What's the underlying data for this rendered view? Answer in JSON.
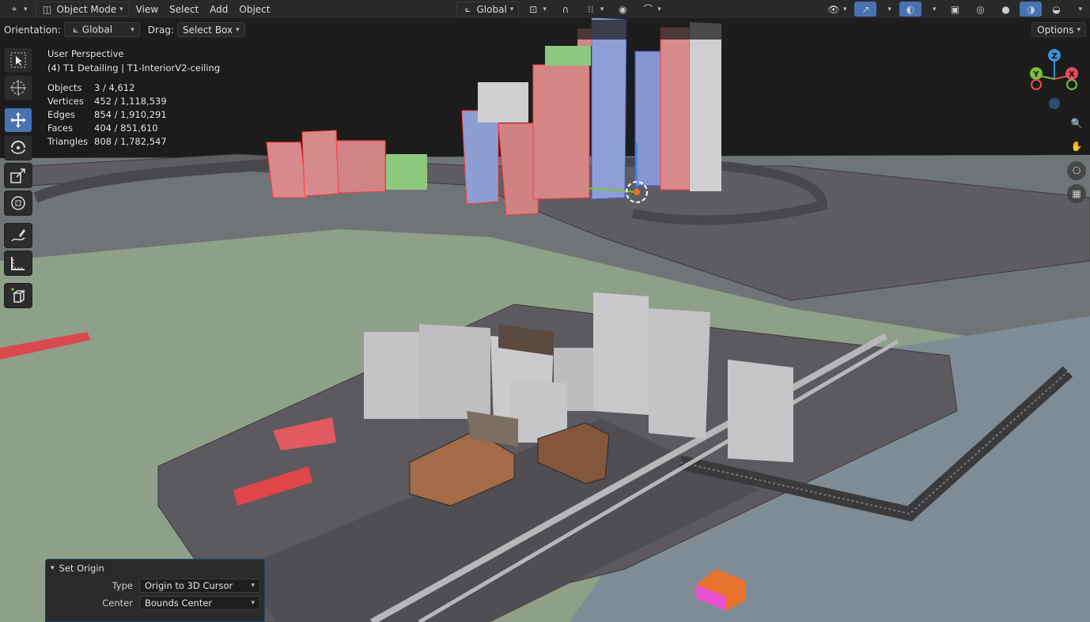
{
  "header": {
    "mode_label": "Object Mode",
    "menus": [
      "View",
      "Select",
      "Add",
      "Object"
    ],
    "transform_orientation": "Global"
  },
  "tool_settings": {
    "orientation_label": "Orientation:",
    "orientation_value": "Global",
    "drag_label": "Drag:",
    "drag_value": "Select Box",
    "options_label": "Options"
  },
  "toolbar": {
    "tools": [
      "select-box-tool-icon",
      "cursor-tool-icon",
      "move-tool-icon",
      "rotate-tool-icon",
      "scale-tool-icon",
      "transform-tool-icon",
      "annotate-tool-icon",
      "measure-tool-icon",
      "add-cube-tool-icon"
    ],
    "active_tool": "move-tool-icon"
  },
  "overlay": {
    "view_name": "User Perspective",
    "collection_info": "(4) T1 Detailing | T1-InteriorV2-ceiling",
    "stats": [
      {
        "label": "Objects",
        "value": "3 / 4,612"
      },
      {
        "label": "Vertices",
        "value": "452 / 1,118,539"
      },
      {
        "label": "Edges",
        "value": "854 / 1,910,291"
      },
      {
        "label": "Faces",
        "value": "404 / 851,610"
      },
      {
        "label": "Triangles",
        "value": "808 / 1,782,547"
      }
    ]
  },
  "gizmo": {
    "x_label": "X",
    "y_label": "Y",
    "z_label": "Z",
    "colors": {
      "x": "#e84a5f",
      "y": "#7bbf3a",
      "z": "#3d8fd6"
    }
  },
  "operator_panel": {
    "title": "Set Origin",
    "type_label": "Type",
    "type_value": "Origin to 3D Cursor",
    "center_label": "Center",
    "center_value": "Bounds Center"
  },
  "colors": {
    "accent": "#4772b3",
    "selected_outline": "#ff3b3b"
  }
}
